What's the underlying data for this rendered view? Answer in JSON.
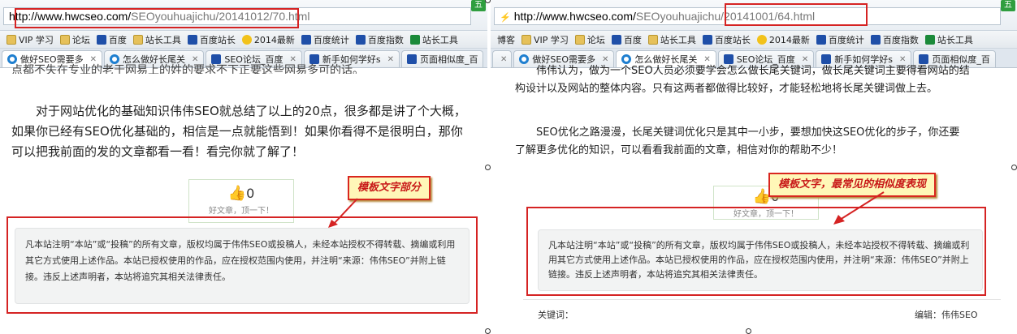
{
  "left": {
    "url_host": "http://www.hwcseo.com/",
    "url_path": "SEOyouhuajichu/20141012/70.html",
    "tool_badge": "五",
    "bookmarks": [
      "VIP 学习",
      "论坛",
      "百度",
      "站长工具",
      "百度站长",
      "2014最新",
      "百度统计",
      "百度指数",
      "站长工具"
    ],
    "tabs": [
      "做好SEO需要多",
      "怎么做好长尾关",
      "SEO论坛_百度",
      "新手如何学好s",
      "页面相似度_百"
    ],
    "partial_top": "点都不失在专业的老于网易上的姓的要求不下正要这些网易多可的话。",
    "paragraph": "对于网站优化的基础知识伟伟SEO就总结了以上的20点，很多都是讲了个大概，如果你已经有SEO优化基础的，相信是一点就能悟到！如果你看得不是很明白，那你可以把我前面的发的文章都看一看！看完你就了解了！",
    "like_count": "0",
    "like_label": "好文章，顶一下！",
    "notice": "凡本站注明“本站”或“投稿”的所有文章，版权均属于伟伟SEO或投稿人，未经本站授权不得转载、摘编或利用其它方式使用上述作品。本站已授权使用的作品，应在授权范围内使用，并注明“来源：伟伟SEO”并附上链接。违反上述声明者，本站将追究其相关法律责任。",
    "callout": "模板文字部分"
  },
  "right": {
    "url_host": "http://www.hwcseo.com/",
    "url_path": "SEOyouhuajichu/20141001/64.html",
    "tool_badge": "五",
    "bookmarks": [
      "博客",
      "VIP 学习",
      "论坛",
      "百度",
      "站长工具",
      "百度站长",
      "2014最新",
      "百度统计",
      "百度指数",
      "站长工具"
    ],
    "tabs": [
      "做好SEO需要多",
      "怎么做好长尾关",
      "SEO论坛_百度",
      "新手如何学好s",
      "页面相似度_百"
    ],
    "paragraph1": "伟伟认为，做为一个SEO人员必须要学会怎么做长尾关键词，做长尾关键词主要得看网站的结构设计以及网站的整体内容。只有这两者都做得比较好，才能轻松地将长尾关键词做上去。",
    "paragraph2": "SEO优化之路漫漫，长尾关键词优化只是其中一小步，要想加快这SEO优化的步子，你还要了解更多优化的知识，可以看看我前面的文章，相信对你的帮助不少！",
    "like_count": "0",
    "like_label": "好文章，顶一下！",
    "notice": "凡本站注明“本站”或“投稿”的所有文章，版权均属于伟伟SEO或投稿人，未经本站授权不得转载、摘编或利用其它方式使用上述作品。本站已授权使用的作品，应在授权范围内使用，并注明“来源：伟伟SEO”并附上链接。违反上述声明者，本站将追究其相关法律责任。",
    "callout": "模板文字，最常见的相似度表现",
    "keywords_label": "关键词：",
    "editor_label": "编辑：伟伟SEO"
  },
  "colors": {
    "annotation_red": "#d52323",
    "callout_bg": "#fff7b8",
    "like_green": "#3aa83a",
    "notice_bg": "#f2f3f3"
  }
}
